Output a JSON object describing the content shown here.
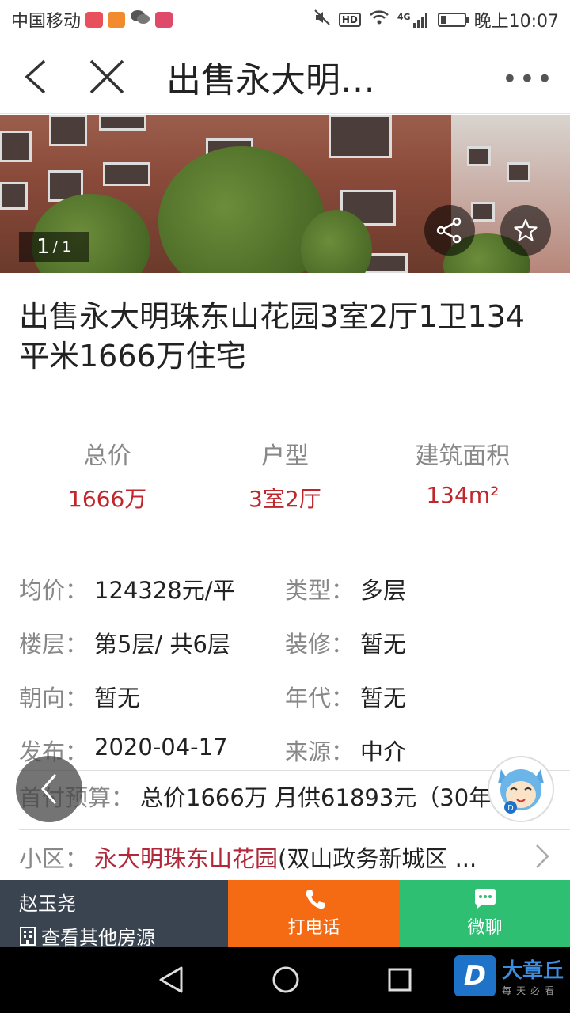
{
  "status_bar": {
    "carrier": "中国移动",
    "hd": "HD",
    "network": "4G",
    "time": "晚上10:07"
  },
  "nav": {
    "title": "出售永大明…",
    "more": "•••"
  },
  "gallery": {
    "current": "1",
    "total": "/ 1"
  },
  "listing": {
    "title": "出售永大明珠东山花园3室2厅1卫134平米1666万住宅"
  },
  "summary": [
    {
      "label": "总价",
      "value": "1666万"
    },
    {
      "label": "户型",
      "value": "3室2厅"
    },
    {
      "label": "建筑面积",
      "value": "134m²"
    }
  ],
  "details": {
    "avg_price": {
      "label": "均价：",
      "value": "124328元/平"
    },
    "type": {
      "label": "类型：",
      "value": "多层"
    },
    "floor": {
      "label": "楼层：",
      "value": "第5层/ 共6层"
    },
    "decoration": {
      "label": "装修：",
      "value": "暂无"
    },
    "orientation": {
      "label": "朝向：",
      "value": "暂无"
    },
    "year": {
      "label": "年代：",
      "value": "暂无"
    },
    "published": {
      "label": "发布：",
      "value": "2020-04-17"
    },
    "source": {
      "label": "来源：",
      "value": "中介"
    }
  },
  "budget": {
    "label": "首付预算：",
    "value": "总价1666万 月供61893元（30年"
  },
  "community": {
    "label": "小区：",
    "name": "永大明珠东山花园",
    "rest": "(双山政务新城区 ..."
  },
  "action_bar": {
    "agent_name": "赵玉尧",
    "other_listings": "查看其他房源",
    "call": "打电话",
    "chat": "微聊"
  },
  "watermark": {
    "logo": "D",
    "name": "大章丘",
    "slogan": "每天必看"
  },
  "colors": {
    "accent_red": "#c0272d",
    "call_orange": "#f46b14",
    "chat_green": "#2fbf72",
    "agent_bg": "#3a4450"
  }
}
